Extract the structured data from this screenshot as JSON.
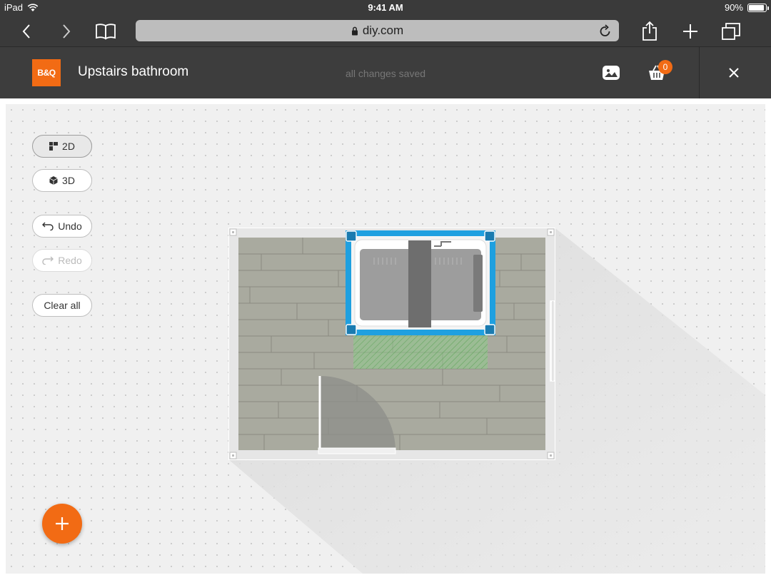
{
  "status_bar": {
    "device": "iPad",
    "time": "9:41 AM",
    "battery": "90%",
    "battery_level": 0.9
  },
  "browser": {
    "url": "diy.com"
  },
  "app": {
    "brand": "B&Q",
    "project_title": "Upstairs bathroom",
    "save_status": "all changes saved",
    "basket_count": "0"
  },
  "sidebar": {
    "view_2d": "2D",
    "view_3d": "3D",
    "undo": "Undo",
    "redo": "Redo",
    "clear_all": "Clear all"
  },
  "colors": {
    "brand": "#f26b14",
    "selection": "#1fa0e0",
    "clearance": "#6dbb6a"
  },
  "icons": [
    "wifi-icon",
    "back-icon",
    "forward-icon",
    "bookmarks-icon",
    "lock-icon",
    "reload-icon",
    "share-icon",
    "new-tab-icon",
    "tabs-icon",
    "gallery-icon",
    "basket-icon",
    "close-icon",
    "grid-2d-icon",
    "cube-3d-icon",
    "undo-icon",
    "redo-icon",
    "add-icon"
  ]
}
